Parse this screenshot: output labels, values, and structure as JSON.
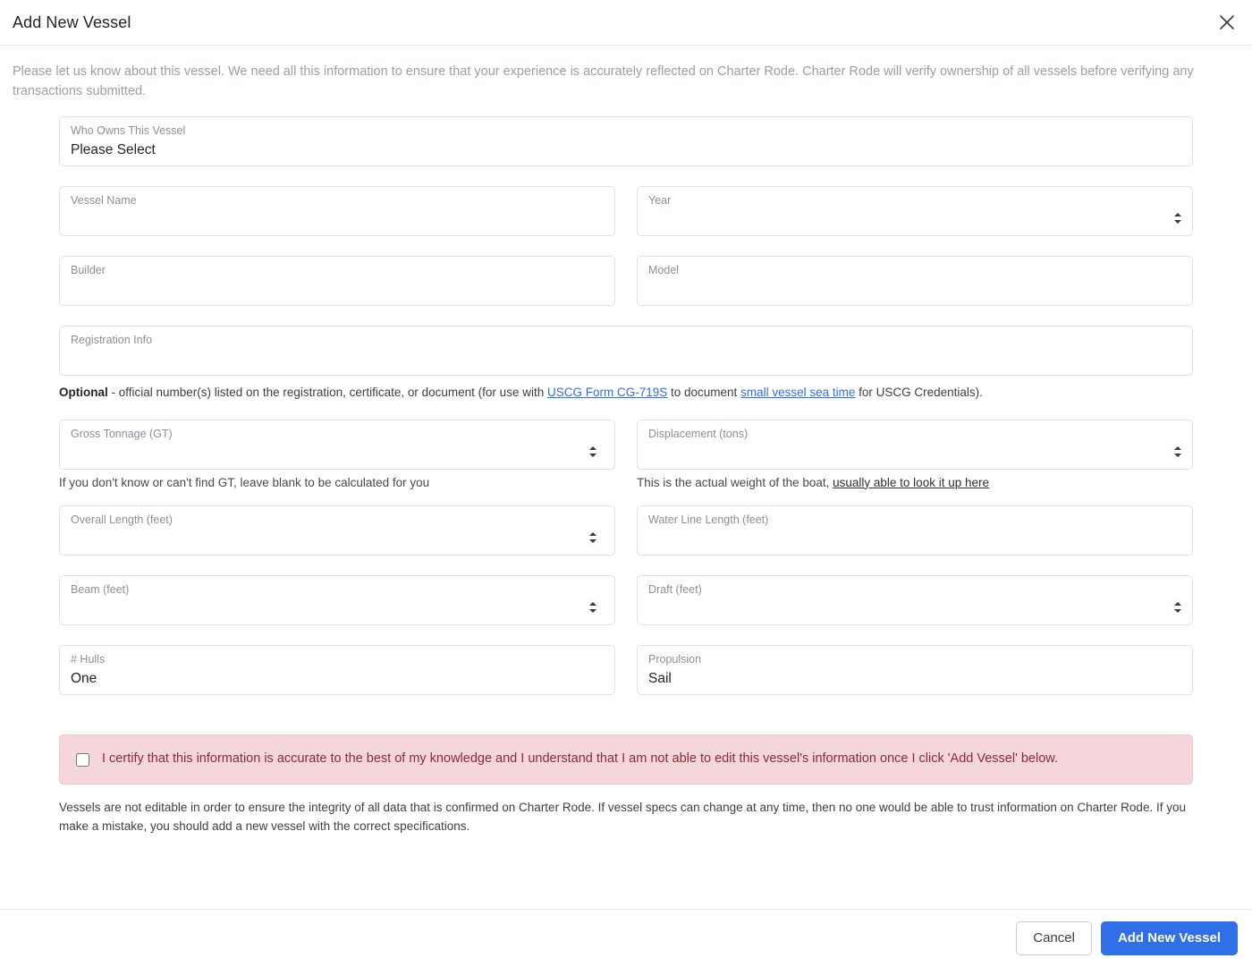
{
  "modal": {
    "title": "Add New Vessel",
    "close_icon": "close-icon",
    "intro": "Please let us know about this vessel. We need all this information to ensure that your experience is accurately reflected on Charter Rode. Charter Rode will verify ownership of all vessels before verifying any transactions submitted."
  },
  "fields": {
    "owner": {
      "label": "Who Owns This Vessel",
      "value": "Please Select"
    },
    "vessel_name": {
      "label": "Vessel Name",
      "value": ""
    },
    "year": {
      "label": "Year",
      "value": ""
    },
    "builder": {
      "label": "Builder",
      "value": ""
    },
    "model": {
      "label": "Model",
      "value": ""
    },
    "registration": {
      "label": "Registration Info",
      "value": ""
    },
    "gross_tonnage": {
      "label": "Gross Tonnage (GT)",
      "value": ""
    },
    "displacement": {
      "label": "Displacement (tons)",
      "value": ""
    },
    "overall_length": {
      "label": "Overall Length (feet)",
      "value": ""
    },
    "water_line_length": {
      "label": "Water Line Length (feet)",
      "value": ""
    },
    "beam": {
      "label": "Beam (feet)",
      "value": ""
    },
    "draft": {
      "label": "Draft (feet)",
      "value": ""
    },
    "hulls": {
      "label": "# Hulls",
      "value": "One"
    },
    "propulsion": {
      "label": "Propulsion",
      "value": "Sail"
    }
  },
  "notes": {
    "registration_optional_bold": "Optional",
    "registration_part1": " - official number(s) listed on the registration, certificate, or document (for use with ",
    "registration_link1": "USCG Form CG-719S",
    "registration_part2": " to document ",
    "registration_link2": "small vessel sea time",
    "registration_part3": " for USCG Credentials).",
    "gross_tonnage_helper": "If you don't know or can't find GT, leave blank to be calculated for you",
    "displacement_helper_text": "This is the actual weight of the boat, ",
    "displacement_helper_link": "usually able to look it up here"
  },
  "alert": {
    "text": "I certify that this information is accurate to the best of my knowledge and I understand that I am not able to edit this vessel's information once I click 'Add Vessel' below.",
    "checked": false,
    "background_color": "#f5d6da",
    "text_color": "#8b2b35"
  },
  "disclaimer": "Vessels are not editable in order to ensure the integrity of all data that is confirmed on Charter Rode. If vessel specs can change at any time, then no one would be able to trust information on Charter Rode. If you make a mistake, you should add a new vessel with the correct specifications.",
  "footer": {
    "cancel_label": "Cancel",
    "submit_label": "Add New Vessel",
    "submit_color": "#2f6fe8"
  }
}
